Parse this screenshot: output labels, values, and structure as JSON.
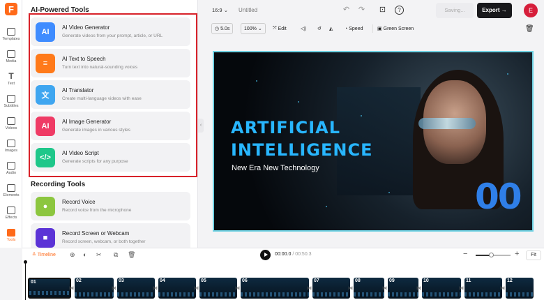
{
  "app": {
    "logo_letter": "F",
    "aspect_ratio": "16:9",
    "aspect_chevron": "⌄",
    "title": "Untitled",
    "saving_label": "Saving...",
    "export_label": "Export →",
    "avatar_initial": "E"
  },
  "rail": {
    "items": [
      {
        "label": "Templates"
      },
      {
        "label": "Media"
      },
      {
        "label": "Text",
        "glyph": "T"
      },
      {
        "label": "Subtitles"
      },
      {
        "label": "Videos"
      },
      {
        "label": "Images"
      },
      {
        "label": "Audio"
      },
      {
        "label": "Elements"
      },
      {
        "label": "Effects"
      },
      {
        "label": "Tools"
      }
    ],
    "active": "Tools"
  },
  "panel": {
    "ai_section_title": "AI-Powered Tools",
    "ai_tools": [
      {
        "title": "AI Video Generator",
        "desc": "Generate videos from your prompt, article, or URL",
        "color": "#3f8cff",
        "glyph": "AI"
      },
      {
        "title": "AI Text to Speech",
        "desc": "Turn text into natural-sounding voices",
        "color": "#ff7a1a",
        "glyph": "≡"
      },
      {
        "title": "AI Translator",
        "desc": "Create multi-language videos with ease",
        "color": "#3fa6f0",
        "glyph": "文"
      },
      {
        "title": "AI Image Generator",
        "desc": "Generate images in various styles",
        "color": "#ef3b65",
        "glyph": "AI"
      },
      {
        "title": "AI Video Script",
        "desc": "Generate scripts for any purpose",
        "color": "#1fc78a",
        "glyph": "</>"
      }
    ],
    "recording_section_title": "Recording Tools",
    "recording_tools": [
      {
        "title": "Record Voice",
        "desc": "Record voice from the microphone",
        "color": "#8cc63f",
        "glyph": "●"
      },
      {
        "title": "Record Screen or Webcam",
        "desc": "Record screen, webcam, or both together",
        "color": "#5b33d6",
        "glyph": "■"
      }
    ]
  },
  "edit_toolbar": {
    "duration": "5.0s",
    "zoom": "100%",
    "edit_label": "Edit",
    "speed_label": "Speed",
    "green_screen_label": "Green Screen"
  },
  "canvas": {
    "headline_1": "ARTIFICIAL",
    "headline_2": "INTELLIGENCE",
    "subtitle": "New Era New Technology",
    "big_number": "00"
  },
  "timeline": {
    "label": "Timeline",
    "current_time": "00:00.0",
    "total_time": "/ 00:50.3",
    "zoom_minus": "−",
    "zoom_plus": "+",
    "zoom_level": 0.44,
    "fit_label": "Fit",
    "clips": [
      "01",
      "02",
      "03",
      "04",
      "05",
      "06",
      "07",
      "08",
      "09",
      "10",
      "11",
      "12"
    ],
    "transition_glyph": "⋈"
  },
  "colors": {
    "accent": "#ff6a1a",
    "highlight_border": "#d8222a",
    "headline": "#28b6ff",
    "number": "#2f7fe8"
  }
}
